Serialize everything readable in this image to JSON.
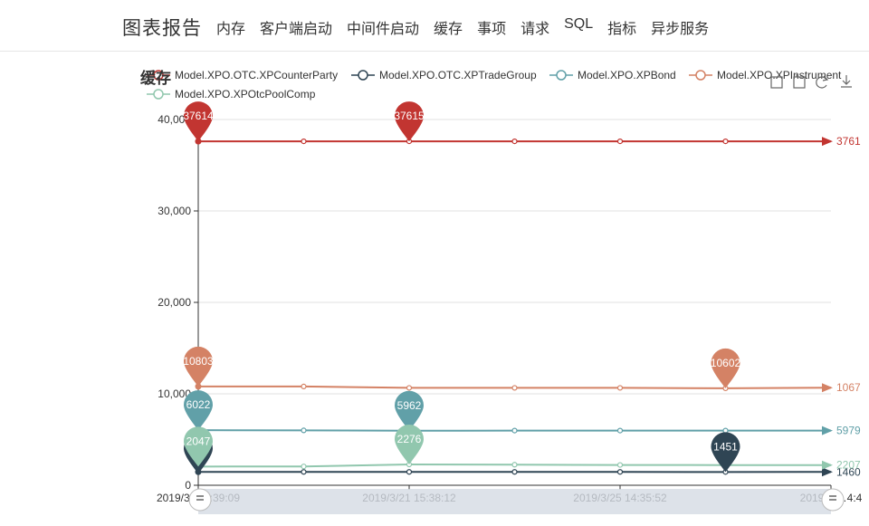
{
  "app": {
    "brand": "图表报告",
    "nav": [
      "内存",
      "客户端启动",
      "中间件启动",
      "缓存",
      "事项",
      "请求",
      "SQL",
      "指标",
      "异步服务"
    ]
  },
  "chart_data": {
    "type": "line",
    "title": "缓存",
    "x": [
      "2019/3/17 11:39:09",
      "",
      "2019/3/21 15:38:12",
      "",
      "2019/3/25 14:35:52",
      "",
      "2019/3/29 14:14:4"
    ],
    "x_tick_labels": [
      "2019/3/…1:39:09",
      "2019/3/21 15:38:12",
      "2019/3/25 14:35:52",
      "2019/3/…4:4"
    ],
    "ylim": [
      0,
      40000
    ],
    "y_ticks": [
      "0",
      "10,000",
      "20,000",
      "30,000",
      "40,000"
    ],
    "grid": true,
    "legend_position": "top",
    "toolbox": [
      "zoom-icon",
      "zoom-reset-icon",
      "restore-icon",
      "download-icon"
    ],
    "series": [
      {
        "name": "Model.XPO.OTC.XPCounterParty",
        "color": "#c23531",
        "values": [
          37614,
          37614,
          37615,
          37614,
          37614,
          37614,
          37614
        ],
        "max_label": "37614",
        "max_label2": "37615",
        "end_label": "3761"
      },
      {
        "name": "Model.XPO.OTC.XPTradeGroup",
        "color": "#2f4554",
        "values": [
          1460,
          1460,
          1460,
          1460,
          1460,
          1451,
          1460
        ],
        "min_label": "1451",
        "end_label": "1460"
      },
      {
        "name": "Model.XPO.XPBond",
        "color": "#61a0a8",
        "values": [
          6022,
          6000,
          5962,
          5979,
          5979,
          5979,
          5979
        ],
        "max_label": "6022",
        "min_label": "5962",
        "end_label": "5979"
      },
      {
        "name": "Model.XPO.XPInstrument",
        "color": "#d48265",
        "values": [
          10803,
          10803,
          10650,
          10650,
          10650,
          10602,
          10670
        ],
        "max_label": "10803",
        "min_label": "10602",
        "end_label": "1067"
      },
      {
        "name": "Model.XPO.XPOtcPoolComp",
        "color": "#91c7ae",
        "values": [
          2047,
          2060,
          2276,
          2250,
          2220,
          2207,
          2207
        ],
        "min_label": "2047",
        "max_label": "2276",
        "end_label": "2207"
      }
    ]
  }
}
